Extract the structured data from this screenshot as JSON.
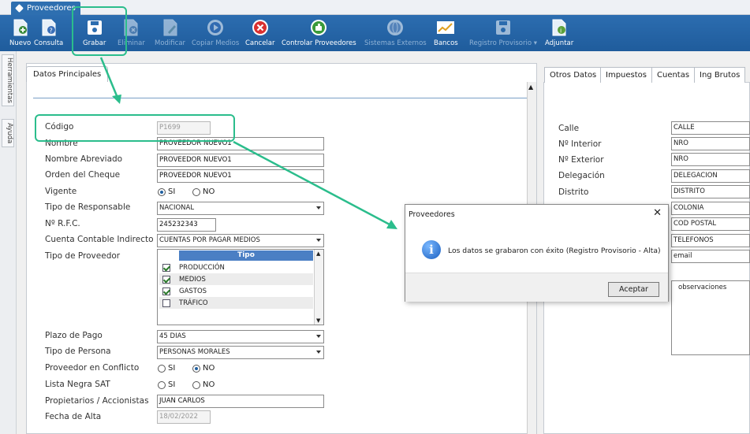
{
  "app": {
    "tab_title": "Proveedores"
  },
  "toolbar": {
    "items": [
      {
        "label": "Nuevo",
        "icon": "new-doc-icon",
        "enabled": true
      },
      {
        "label": "Consulta",
        "icon": "query-doc-icon",
        "enabled": true
      },
      {
        "label": "Grabar",
        "icon": "save-disk-icon",
        "enabled": true
      },
      {
        "label": "Eliminar",
        "icon": "delete-doc-icon",
        "enabled": false
      },
      {
        "label": "Modificar",
        "icon": "edit-doc-icon",
        "enabled": false
      },
      {
        "label": "Copiar Medios",
        "icon": "play-circle-icon",
        "enabled": false
      },
      {
        "label": "Cancelar",
        "icon": "cancel-x-icon",
        "enabled": true
      },
      {
        "label": "Controlar Proveedores",
        "icon": "thumbs-up-icon",
        "enabled": true
      },
      {
        "label": "Sistemas Externos",
        "icon": "globe-icon",
        "enabled": false
      },
      {
        "label": "Bancos",
        "icon": "chart-line-icon",
        "enabled": true
      },
      {
        "label": "Registro Provisorio ▾",
        "icon": "save-disk-icon",
        "enabled": false
      },
      {
        "label": "Adjuntar",
        "icon": "attach-doc-icon",
        "enabled": true
      }
    ]
  },
  "sidebar": {
    "tabs": [
      "Herramientas",
      "Ayuda"
    ]
  },
  "left_panel": {
    "tab_label": "Datos Principales",
    "fields": {
      "codigo": {
        "label": "Código",
        "value": "P1699"
      },
      "nombre": {
        "label": "Nombre",
        "value": "PROVEEDOR NUEVO1"
      },
      "nombre_abreviado": {
        "label": "Nombre Abreviado",
        "value": "PROVEEDOR NUEVO1"
      },
      "orden_cheque": {
        "label": "Orden del Cheque",
        "value": "PROVEEDOR NUEVO1"
      },
      "vigente": {
        "label": "Vigente",
        "option_si": "SI",
        "option_no": "NO",
        "selected": "SI"
      },
      "tipo_responsable": {
        "label": "Tipo de Responsable",
        "value": "NACIONAL"
      },
      "rfc": {
        "label": "Nº R.F.C.",
        "value": "245232343"
      },
      "cuenta_contable": {
        "label": "Cuenta Contable Indirecto",
        "value": "CUENTAS POR PAGAR MEDIOS"
      },
      "tipo_proveedor": {
        "label": "Tipo de Proveedor",
        "column_header": "Tipo",
        "rows": [
          {
            "label": "PRODUCCIÓN",
            "checked": true
          },
          {
            "label": "MEDIOS",
            "checked": true
          },
          {
            "label": "GASTOS",
            "checked": true
          },
          {
            "label": "TRÁFICO",
            "checked": false
          }
        ]
      },
      "plazo_pago": {
        "label": "Plazo de Pago",
        "value": "45 DIAS"
      },
      "tipo_persona": {
        "label": "Tipo de Persona",
        "value": "PERSONAS MORALES"
      },
      "proveedor_conflicto": {
        "label": "Proveedor en Conflicto",
        "option_si": "SI",
        "option_no": "NO",
        "selected": "NO"
      },
      "lista_negra": {
        "label": "Lista Negra SAT",
        "option_si": "SI",
        "option_no": "NO",
        "selected": "none"
      },
      "propietarios": {
        "label": "Propietarios / Accionistas",
        "value": "JUAN CARLOS"
      },
      "fecha_alta": {
        "label": "Fecha de Alta",
        "value": "18/02/2022"
      }
    }
  },
  "right_panel": {
    "tabs": [
      "Otros Datos",
      "Impuestos",
      "Cuentas",
      "Ing Brutos"
    ],
    "fields": [
      {
        "label": "Calle",
        "value": "CALLE"
      },
      {
        "label": "Nº Interior",
        "value": "NRO"
      },
      {
        "label": "Nº Exterior",
        "value": "NRO"
      },
      {
        "label": "Delegación",
        "value": "DELEGACION"
      },
      {
        "label": "Distrito",
        "value": "DISTRITO"
      },
      {
        "label": "",
        "value": "COLONIA"
      },
      {
        "label": "",
        "value": "COD POSTAL"
      },
      {
        "label": "",
        "value": "TELEFONOS"
      },
      {
        "label": "",
        "value": "email"
      }
    ],
    "observaciones": "observaciones"
  },
  "dialog": {
    "title": "Proveedores",
    "close": "✕",
    "icon": "info-icon",
    "message": "Los datos se grabaron con éxito (Registro Provisorio - Alta)",
    "ok_label": "Aceptar"
  },
  "colors": {
    "toolbar": "#1f5c9c",
    "highlight": "#2bbd8c",
    "tipo_header": "#4b7fc4"
  }
}
